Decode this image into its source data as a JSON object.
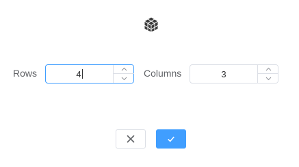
{
  "logo": {
    "icon": "cube-logo-icon"
  },
  "rows": {
    "label": "Rows",
    "value": "4"
  },
  "columns": {
    "label": "Columns",
    "value": "3"
  },
  "buttons": {
    "cancel_icon": "close-icon",
    "confirm_icon": "check-icon"
  },
  "colors": {
    "accent": "#409eff",
    "border": "#dcdfe6",
    "text": "#606266"
  }
}
